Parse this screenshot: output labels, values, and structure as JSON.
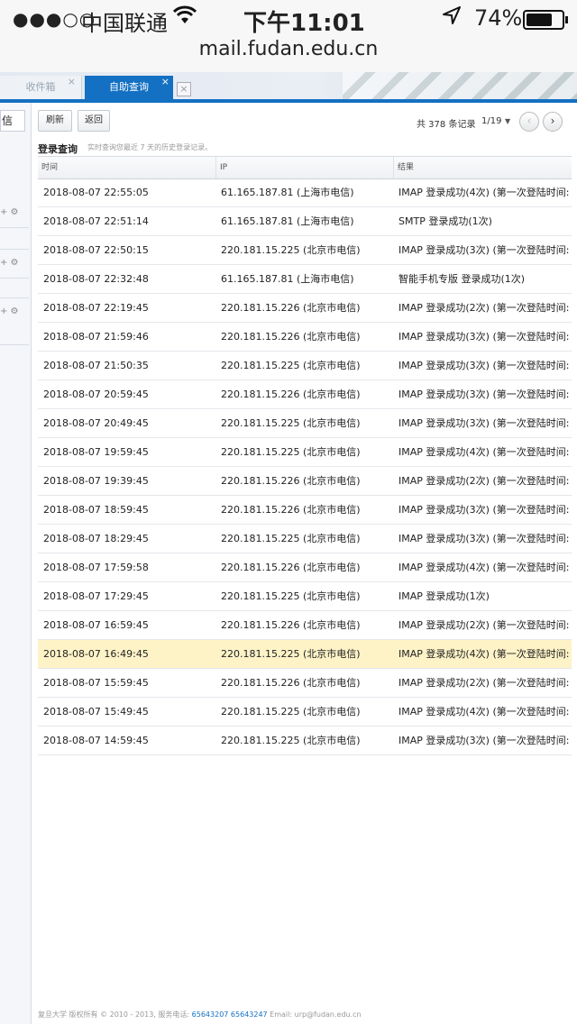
{
  "status_bar": {
    "signal": "●●●○○",
    "carrier": "中国联通",
    "wifi_icon": "wifi-icon",
    "time": "下午11:01",
    "location_icon": "location-arrow-icon",
    "battery_text": "74%",
    "battery_level": 0.74
  },
  "url": "mail.fudan.edu.cn",
  "tabs": [
    {
      "label": "收件箱",
      "close": "×",
      "active": false
    },
    {
      "label": "自助查询",
      "close": "×",
      "active": true
    }
  ],
  "tab_close_all": "×",
  "sidebar": {
    "box_label": "信",
    "group_icons": "+ ⚙"
  },
  "toolbar": {
    "refresh_label": "刷新",
    "back_label": "返回"
  },
  "pager": {
    "summary": "共 378 条记录",
    "page": "1/19",
    "caret": "▼",
    "prev": "‹",
    "next": "›"
  },
  "section": {
    "title": "登录查询",
    "hint": "实时查询您最近 7 天的历史登录记录。"
  },
  "table": {
    "headers": {
      "time": "时间",
      "ip": "IP",
      "result": "结果"
    },
    "rows": [
      {
        "time": "2018-08-07 22:55:05",
        "ip": "61.165.187.81 (上海市电信)",
        "result": "IMAP 登录成功(4次) (第一次登陆时间:"
      },
      {
        "time": "2018-08-07 22:51:14",
        "ip": "61.165.187.81 (上海市电信)",
        "result": "SMTP 登录成功(1次)"
      },
      {
        "time": "2018-08-07 22:50:15",
        "ip": "220.181.15.225 (北京市电信)",
        "result": "IMAP 登录成功(3次) (第一次登陆时间:"
      },
      {
        "time": "2018-08-07 22:32:48",
        "ip": "61.165.187.81 (上海市电信)",
        "result": "智能手机专版 登录成功(1次)"
      },
      {
        "time": "2018-08-07 22:19:45",
        "ip": "220.181.15.226 (北京市电信)",
        "result": "IMAP 登录成功(2次) (第一次登陆时间:"
      },
      {
        "time": "2018-08-07 21:59:46",
        "ip": "220.181.15.226 (北京市电信)",
        "result": "IMAP 登录成功(3次) (第一次登陆时间:"
      },
      {
        "time": "2018-08-07 21:50:35",
        "ip": "220.181.15.225 (北京市电信)",
        "result": "IMAP 登录成功(3次) (第一次登陆时间:"
      },
      {
        "time": "2018-08-07 20:59:45",
        "ip": "220.181.15.226 (北京市电信)",
        "result": "IMAP 登录成功(3次) (第一次登陆时间:"
      },
      {
        "time": "2018-08-07 20:49:45",
        "ip": "220.181.15.225 (北京市电信)",
        "result": "IMAP 登录成功(3次) (第一次登陆时间:"
      },
      {
        "time": "2018-08-07 19:59:45",
        "ip": "220.181.15.225 (北京市电信)",
        "result": "IMAP 登录成功(4次) (第一次登陆时间:"
      },
      {
        "time": "2018-08-07 19:39:45",
        "ip": "220.181.15.226 (北京市电信)",
        "result": "IMAP 登录成功(2次) (第一次登陆时间:"
      },
      {
        "time": "2018-08-07 18:59:45",
        "ip": "220.181.15.226 (北京市电信)",
        "result": "IMAP 登录成功(3次) (第一次登陆时间:"
      },
      {
        "time": "2018-08-07 18:29:45",
        "ip": "220.181.15.225 (北京市电信)",
        "result": "IMAP 登录成功(3次) (第一次登陆时间:"
      },
      {
        "time": "2018-08-07 17:59:58",
        "ip": "220.181.15.226 (北京市电信)",
        "result": "IMAP 登录成功(4次) (第一次登陆时间:"
      },
      {
        "time": "2018-08-07 17:29:45",
        "ip": "220.181.15.225 (北京市电信)",
        "result": "IMAP 登录成功(1次)"
      },
      {
        "time": "2018-08-07 16:59:45",
        "ip": "220.181.15.226 (北京市电信)",
        "result": "IMAP 登录成功(2次) (第一次登陆时间:"
      },
      {
        "time": "2018-08-07 16:49:45",
        "ip": "220.181.15.225 (北京市电信)",
        "result": "IMAP 登录成功(4次) (第一次登陆时间:",
        "highlighted": true
      },
      {
        "time": "2018-08-07 15:59:45",
        "ip": "220.181.15.226 (北京市电信)",
        "result": "IMAP 登录成功(2次) (第一次登陆时间:"
      },
      {
        "time": "2018-08-07 15:49:45",
        "ip": "220.181.15.225 (北京市电信)",
        "result": "IMAP 登录成功(4次) (第一次登陆时间:"
      },
      {
        "time": "2018-08-07 14:59:45",
        "ip": "220.181.15.225 (北京市电信)",
        "result": "IMAP 登录成功(3次) (第一次登陆时间:"
      }
    ]
  },
  "footer": {
    "copyright": "复旦大学 版权所有 © 2010 - 2013, 服务电话: ",
    "phones": "65643207 65643247",
    "email": " Email: urp@fudan.edu.cn"
  },
  "colors": {
    "accent": "#1470c2",
    "highlight_row": "#fef3c7"
  }
}
